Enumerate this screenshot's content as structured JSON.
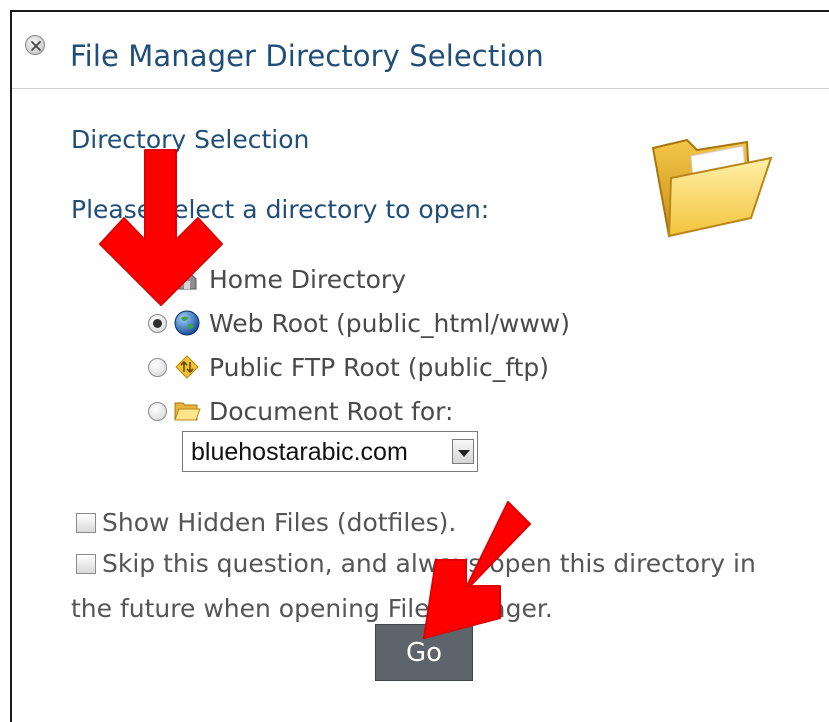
{
  "dialog": {
    "title": "File Manager Directory Selection",
    "close_icon": "close-icon"
  },
  "form": {
    "section_title": "Directory Selection",
    "prompt": "Please select a directory to open:",
    "options": [
      {
        "label": "Home Directory",
        "icon": "home-icon",
        "checked": false
      },
      {
        "label": "Web Root (public_html/www)",
        "icon": "globe-icon",
        "checked": true
      },
      {
        "label": "Public FTP Root (public_ftp)",
        "icon": "ftp-icon",
        "checked": false
      },
      {
        "label": "Document Root for:",
        "icon": "folder-icon",
        "checked": false
      }
    ],
    "domain_select": {
      "value": "bluehostarabic.com"
    },
    "checkboxes": [
      {
        "label": "Show Hidden Files (dotfiles).",
        "checked": false
      },
      {
        "label": "Skip this question, and always open this directory in",
        "checked": false
      }
    ],
    "skip_continuation": "the future when opening File Manager.",
    "go_label": "Go"
  },
  "colors": {
    "title": "#1f4e79",
    "annotation_arrow": "#ff0000",
    "go_button": "#5d646c"
  }
}
